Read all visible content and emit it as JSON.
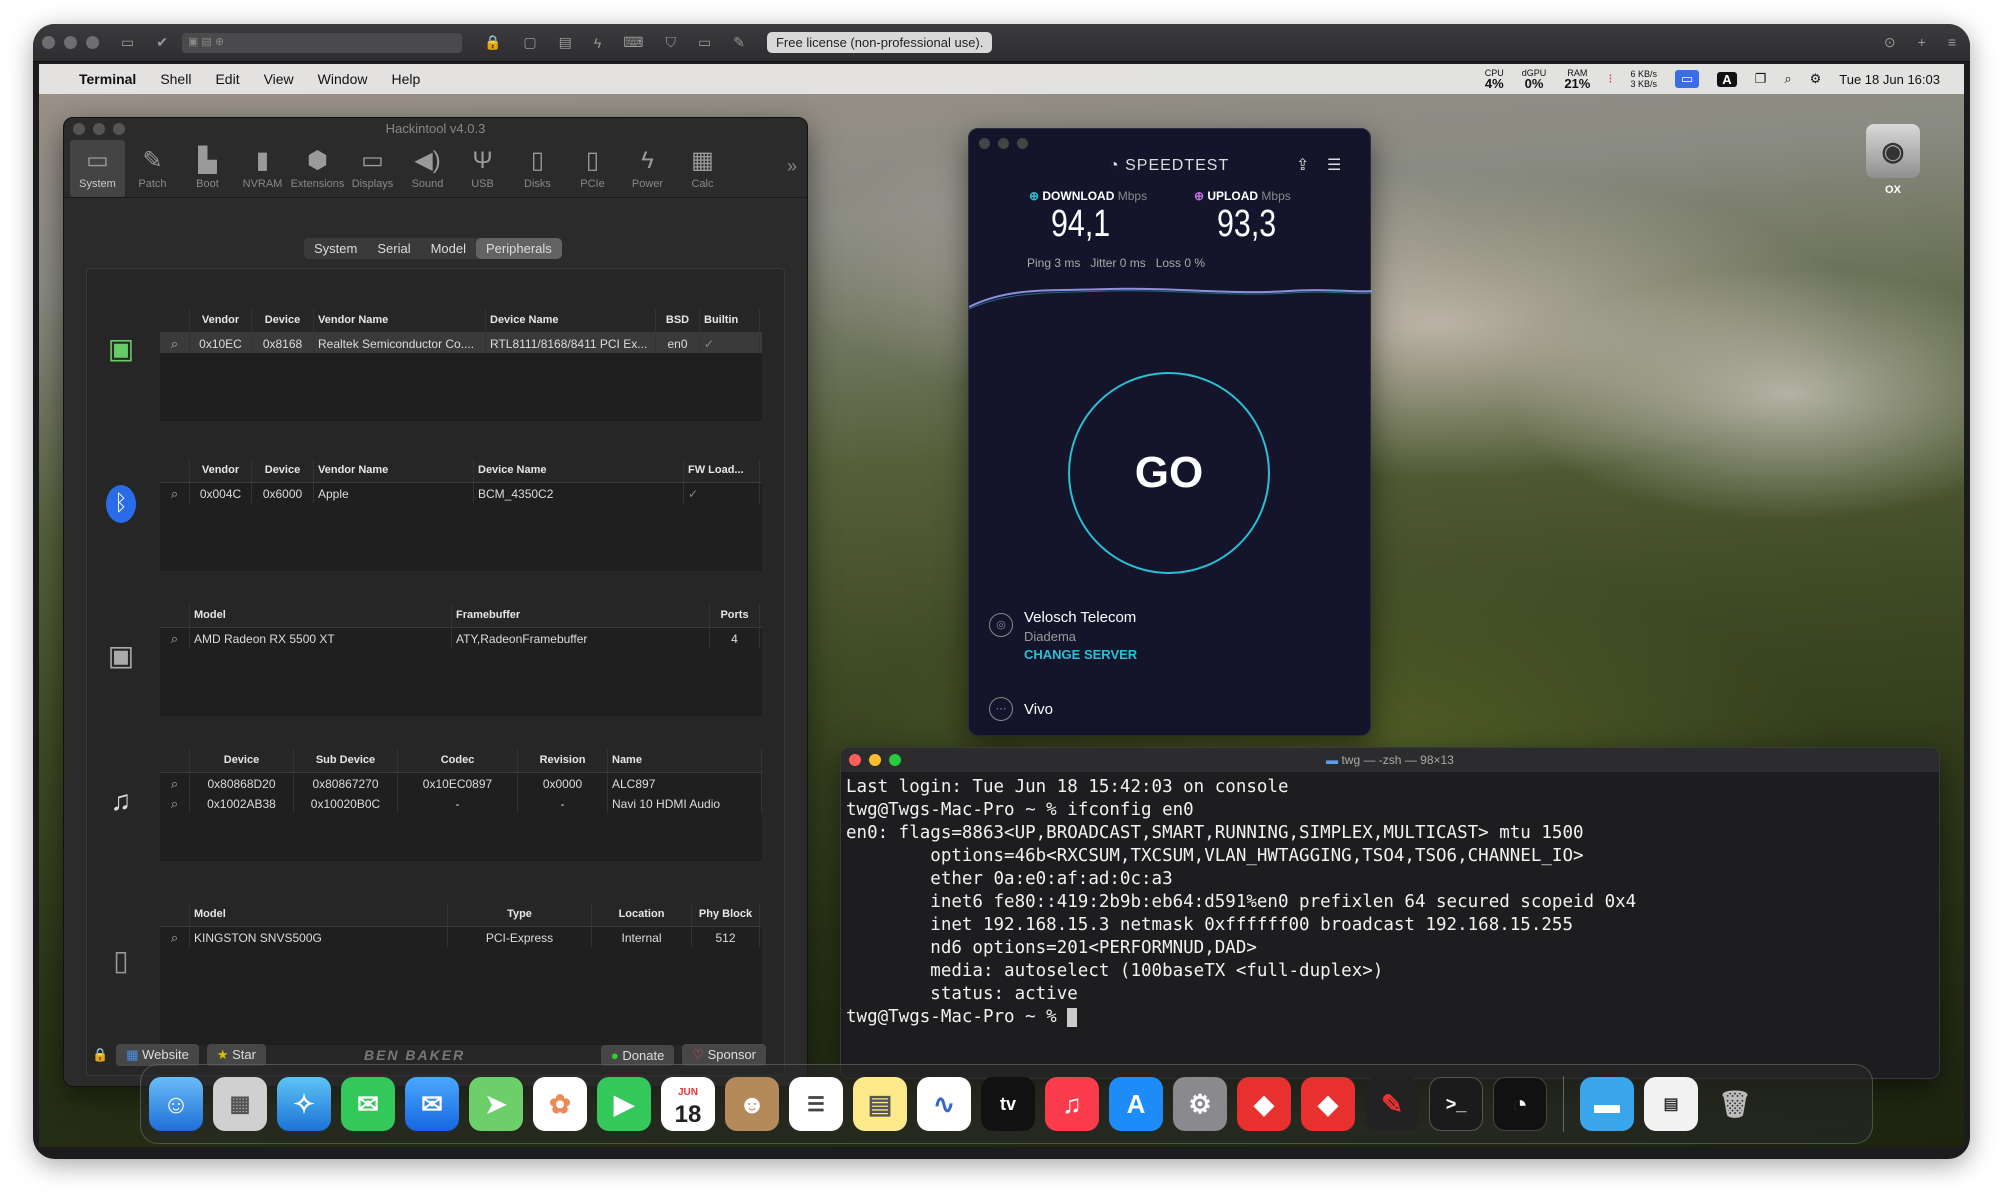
{
  "vm_toolbar": {
    "license": "Free license (non-professional use)."
  },
  "menubar": {
    "app": "Terminal",
    "items": [
      "Shell",
      "Edit",
      "View",
      "Window",
      "Help"
    ],
    "cpu_label": "CPU",
    "cpu": "4%",
    "gpu_label": "dGPU",
    "gpu": "0%",
    "ram_label": "RAM",
    "ram": "21%",
    "net_up": "6 KB/s",
    "net_down": "3 KB/s",
    "input_badge": "A",
    "datetime": "Tue 18 Jun  16:03"
  },
  "desktop": {
    "disk_label": "OX"
  },
  "hackintool": {
    "title": "Hackintool v4.0.3",
    "tools": [
      "System",
      "Patch",
      "Boot",
      "NVRAM",
      "Extensions",
      "Displays",
      "Sound",
      "USB",
      "Disks",
      "PCIe",
      "Power",
      "Calc"
    ],
    "segments": [
      "System",
      "Serial",
      "Model",
      "Peripherals"
    ],
    "network": {
      "headers": [
        "",
        "Vendor",
        "Device",
        "Vendor Name",
        "Device Name",
        "BSD",
        "Builtin"
      ],
      "row": [
        "0x10EC",
        "0x8168",
        "Realtek Semiconductor Co....",
        "RTL8111/8168/8411 PCI Ex...",
        "en0",
        "✓"
      ]
    },
    "bluetooth": {
      "headers": [
        "",
        "Vendor",
        "Device",
        "Vendor Name",
        "Device Name",
        "FW Load..."
      ],
      "row": [
        "0x004C",
        "0x6000",
        "Apple",
        "BCM_4350C2",
        "✓"
      ]
    },
    "graphics": {
      "headers": [
        "",
        "Model",
        "Framebuffer",
        "Ports"
      ],
      "row": [
        "AMD Radeon RX 5500 XT",
        "ATY,RadeonFramebuffer",
        "4"
      ]
    },
    "audio": {
      "headers": [
        "",
        "Device",
        "Sub Device",
        "Codec",
        "Revision",
        "Name"
      ],
      "rows": [
        [
          "0x80868D20",
          "0x80867270",
          "0x10EC0897",
          "0x0000",
          "ALC897"
        ],
        [
          "0x1002AB38",
          "0x10020B0C",
          "-",
          "-",
          "Navi 10 HDMI Audio"
        ]
      ]
    },
    "storage": {
      "headers": [
        "",
        "Model",
        "Type",
        "Location",
        "Phy Block"
      ],
      "row": [
        "KINGSTON SNVS500G",
        "PCI-Express",
        "Internal",
        "512"
      ]
    },
    "footer": {
      "website": "Website",
      "star": "Star",
      "brand": "BEN BAKER",
      "donate": "Donate",
      "sponsor": "Sponsor"
    }
  },
  "speedtest": {
    "title": "SPEEDTEST",
    "download_label": "DOWNLOAD",
    "upload_label": "UPLOAD",
    "unit": "Mbps",
    "download": "94,1",
    "upload": "93,3",
    "ping": "Ping 3 ms",
    "jitter": "Jitter 0 ms",
    "loss": "Loss 0 %",
    "go": "GO",
    "isp": "Velosch Telecom",
    "city": "Diadema",
    "change_server": "CHANGE SERVER",
    "provider": "Vivo"
  },
  "terminal": {
    "title": "twg — -zsh — 98×13",
    "lines": [
      "Last login: Tue Jun 18 15:42:03 on console",
      "twg@Twgs-Mac-Pro ~ % ifconfig en0",
      "en0: flags=8863<UP,BROADCAST,SMART,RUNNING,SIMPLEX,MULTICAST> mtu 1500",
      "        options=46b<RXCSUM,TXCSUM,VLAN_HWTAGGING,TSO4,TSO6,CHANNEL_IO>",
      "        ether 0a:e0:af:ad:0c:a3",
      "        inet6 fe80::419:2b9b:eb64:d591%en0 prefixlen 64 secured scopeid 0x4",
      "        inet 192.168.15.3 netmask 0xffffff00 broadcast 192.168.15.255",
      "        nd6 options=201<PERFORMNUD,DAD>",
      "        media: autoselect (100baseTX <full-duplex>)",
      "        status: active",
      "twg@Twgs-Mac-Pro ~ % "
    ]
  },
  "dock": {
    "calendar_month": "JUN",
    "calendar_day": "18",
    "tv": "tv"
  }
}
